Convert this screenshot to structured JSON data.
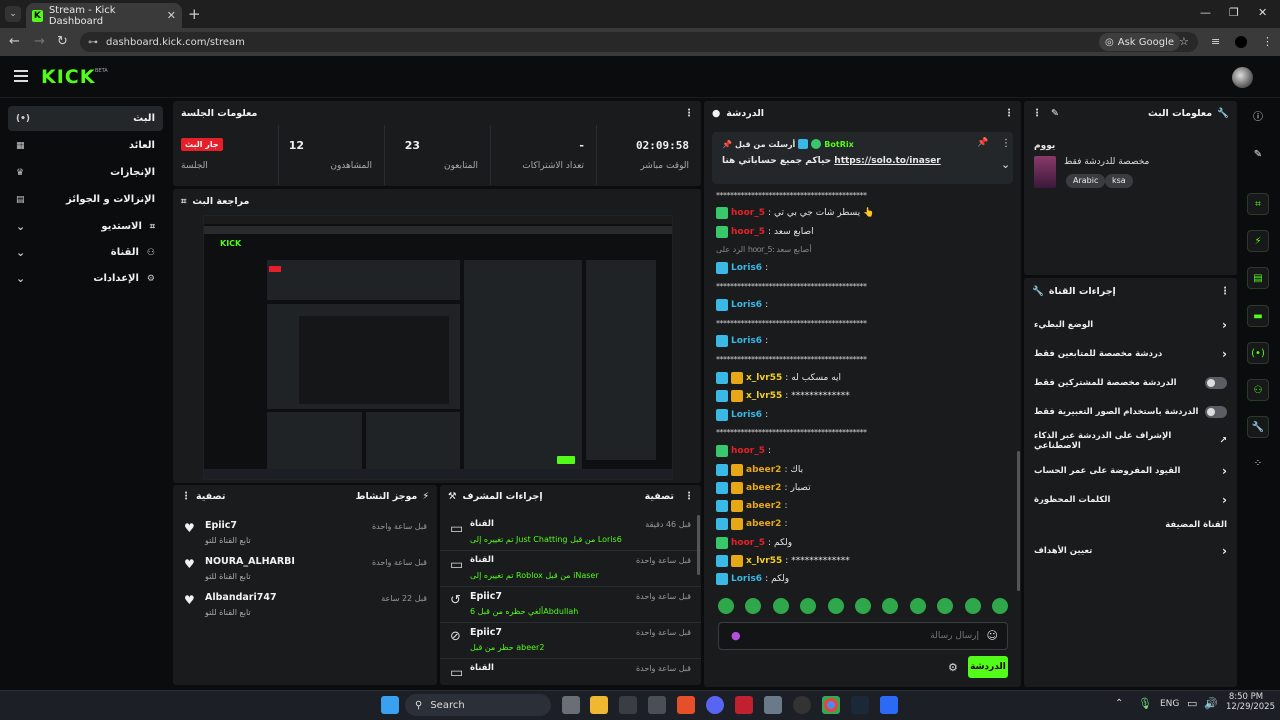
{
  "browser": {
    "tab_title": "Stream - Kick Dashboard",
    "url": "dashboard.kick.com/stream",
    "ask_google": "Ask Google"
  },
  "app": {
    "logo": "KICK",
    "beta": "BETA"
  },
  "nav": {
    "items": [
      {
        "label": "البث",
        "icon": "(•)"
      },
      {
        "label": "العائد",
        "icon": "▦"
      },
      {
        "label": "الإنجازات",
        "icon": "🏆"
      },
      {
        "label": "الإنزالات و الجوائز",
        "icon": "▤"
      },
      {
        "label": "الاستديو",
        "icon": "⌗"
      },
      {
        "label": "القناة",
        "icon": "⚇"
      },
      {
        "label": "الإعدادات",
        "icon": "⚙"
      }
    ]
  },
  "session": {
    "title": "معلومات الجلسة",
    "stats": [
      {
        "value": "02:09:58",
        "label": "الوقت مباشر"
      },
      {
        "value": "-",
        "label": "تعداد الاشتراكات"
      },
      {
        "value": "23",
        "label": "المتابعون"
      },
      {
        "value": "12",
        "label": "المشاهدون"
      },
      {
        "value": "جار البث",
        "label": "الجلسة"
      }
    ]
  },
  "preview": {
    "title": "مراجعة البث"
  },
  "activity": {
    "title": "موجز النشاط",
    "filter": "تصفية",
    "items": [
      {
        "name": "Epiic7",
        "sub": "تابع القناة للتو",
        "time": "قبل ساعة واحدة"
      },
      {
        "name": "NOURA_ALHARBI",
        "sub": "تابع القناة للتو",
        "time": "قبل ساعة واحدة"
      },
      {
        "name": "Albandari747",
        "sub": "تابع القناة للتو",
        "time": "قبل 22 ساعة"
      }
    ]
  },
  "mod": {
    "title": "إجراءات المشرف",
    "filter": "تصفية",
    "items": [
      {
        "head": "القناة",
        "line": "تم تغييره إلى Just Chatting من قبل Loris6",
        "time": "قبل 46 دقيقة",
        "icon": "▭"
      },
      {
        "head": "القناة",
        "line": "تم تغييره إلى Roblox من قبل iNaser",
        "time": "قبل ساعة واحدة",
        "icon": "▭"
      },
      {
        "head": "Epiic7",
        "line": "ألغي حظره من قبل 6Abdullah",
        "time": "قبل ساعة واحدة",
        "icon": "↺"
      },
      {
        "head": "Epiic7",
        "line": "حظر من قبل abeer2",
        "time": "قبل ساعة واحدة",
        "icon": "⊘"
      },
      {
        "head": "القناة",
        "line": "",
        "time": "قبل ساعة واحدة",
        "icon": "▭"
      }
    ]
  },
  "chat": {
    "title": "الدردشة",
    "pinned": {
      "by": "أرسلت من قبل",
      "user": "BotRix",
      "text": "حياكم جميع حساباتي هنا",
      "link": "https://solo.to/inaser"
    },
    "messages": [
      {
        "user": "",
        "text": "*******************************************",
        "color": "#cfcfcf",
        "badges": []
      },
      {
        "user": "hoor_5",
        "text": "يسطر شات جي بي تي 👆",
        "color": "#e5202a",
        "badges": [
          "green"
        ]
      },
      {
        "user": "hoor_5",
        "text": "اصابع سعد",
        "color": "#e5202a",
        "badges": [
          "green"
        ]
      },
      {
        "user": "",
        "text": "الرد على hoor_5: أصابع سعد",
        "color": "#888",
        "badges": []
      },
      {
        "user": "Loris6",
        "text": "",
        "color": "#3ab8e6",
        "badges": [
          "blue"
        ]
      },
      {
        "user": "",
        "text": "*******************************************",
        "color": "#cfcfcf",
        "badges": []
      },
      {
        "user": "Loris6",
        "text": "",
        "color": "#3ab8e6",
        "badges": [
          "blue"
        ]
      },
      {
        "user": "",
        "text": "*******************************************",
        "color": "#cfcfcf",
        "badges": []
      },
      {
        "user": "Loris6",
        "text": "",
        "color": "#3ab8e6",
        "badges": [
          "blue"
        ]
      },
      {
        "user": "",
        "text": "*******************************************",
        "color": "#cfcfcf",
        "badges": []
      },
      {
        "user": "x_lvr55",
        "text": "ايه مسكب له",
        "color": "#f5d020",
        "badges": [
          "blue",
          "gold"
        ]
      },
      {
        "user": "x_lvr55",
        "text": "*************",
        "color": "#f5d020",
        "badges": [
          "blue",
          "gold"
        ]
      },
      {
        "user": "Loris6",
        "text": "",
        "color": "#3ab8e6",
        "badges": [
          "blue"
        ]
      },
      {
        "user": "",
        "text": "*******************************************",
        "color": "#cfcfcf",
        "badges": []
      },
      {
        "user": "hoor_5",
        "text": "",
        "color": "#e5202a",
        "badges": [
          "green"
        ]
      },
      {
        "user": "abeer2",
        "text": "باك",
        "color": "#e6a817",
        "badges": [
          "blue",
          "gold"
        ]
      },
      {
        "user": "abeer2",
        "text": "تصبار",
        "color": "#e6a817",
        "badges": [
          "blue",
          "gold"
        ]
      },
      {
        "user": "abeer2",
        "text": "",
        "color": "#e6a817",
        "badges": [
          "blue",
          "gold"
        ]
      },
      {
        "user": "abeer2",
        "text": "",
        "color": "#e6a817",
        "badges": [
          "blue",
          "gold"
        ]
      },
      {
        "user": "hoor_5",
        "text": "ولكم",
        "color": "#e5202a",
        "badges": [
          "green"
        ]
      },
      {
        "user": "x_lvr55",
        "text": "*************",
        "color": "#f5d020",
        "badges": [
          "blue",
          "gold"
        ]
      },
      {
        "user": "Loris6",
        "text": "ولكم",
        "color": "#3ab8e6",
        "badges": [
          "blue"
        ]
      }
    ],
    "placeholder": "إرسال رسالة",
    "send": "الدردشة"
  },
  "stream_info": {
    "title": "معلومات البث",
    "stream_title": "يووم",
    "category": "مخصصة للدردشة فقط",
    "tags": [
      "Arabic",
      "ksa"
    ]
  },
  "channel_actions": {
    "title": "إجراءات القناة",
    "items": [
      {
        "label": "الوضع البطيء",
        "kind": "chevron"
      },
      {
        "label": "دردشة مخصصة للمتابعين فقط",
        "kind": "chevron"
      },
      {
        "label": "الدردشة مخصصة للمشتركين فقط",
        "kind": "toggle"
      },
      {
        "label": "الدردشة باستخدام الصور التعبيرية فقط",
        "kind": "toggle"
      },
      {
        "label": "الإشراف على الدردشة عبر الذكاء الاصطناعي",
        "kind": "external"
      },
      {
        "label": "القيود المفروضة على عمر الحساب",
        "kind": "chevron"
      },
      {
        "label": "الكلمات المحظورة",
        "kind": "chevron"
      },
      {
        "label": "القناة المضيفة",
        "kind": "none"
      },
      {
        "label": "تعيين الأهداف",
        "kind": "chevron"
      }
    ]
  },
  "taskbar": {
    "search": "Search",
    "lang": "ENG",
    "time": "8:50 PM",
    "date": "12/29/2025"
  }
}
